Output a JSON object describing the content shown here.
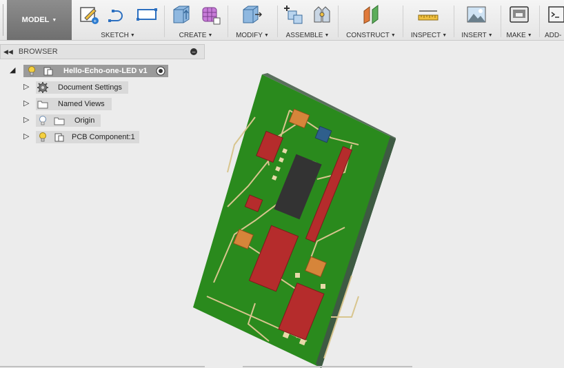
{
  "toolbar": {
    "workspace": "MODEL",
    "groups": {
      "sketch": "SKETCH",
      "create": "CREATE",
      "modify": "MODIFY",
      "assemble": "ASSEMBLE",
      "construct": "CONSTRUCT",
      "inspect": "INSPECT",
      "insert": "INSERT",
      "make": "MAKE",
      "addins": "ADD-"
    }
  },
  "browser": {
    "title": "BROWSER",
    "root": "Hello-Echo-one-LED v1",
    "items": [
      {
        "label": "Document Settings",
        "icon": "gear-icon"
      },
      {
        "label": "Named Views",
        "icon": "folder-icon"
      },
      {
        "label": "Origin",
        "icon": "folder-icon"
      },
      {
        "label": "PCB Component:1",
        "icon": "component-icon"
      }
    ]
  },
  "colors": {
    "board_green": "#2a8a1d",
    "board_side": "#3e5a43",
    "pad_red": "#b52c2c",
    "pad_orange": "#d6853a",
    "trace": "#d8c58e",
    "chip": "#333333",
    "led_blue": "#2f5f8c"
  }
}
